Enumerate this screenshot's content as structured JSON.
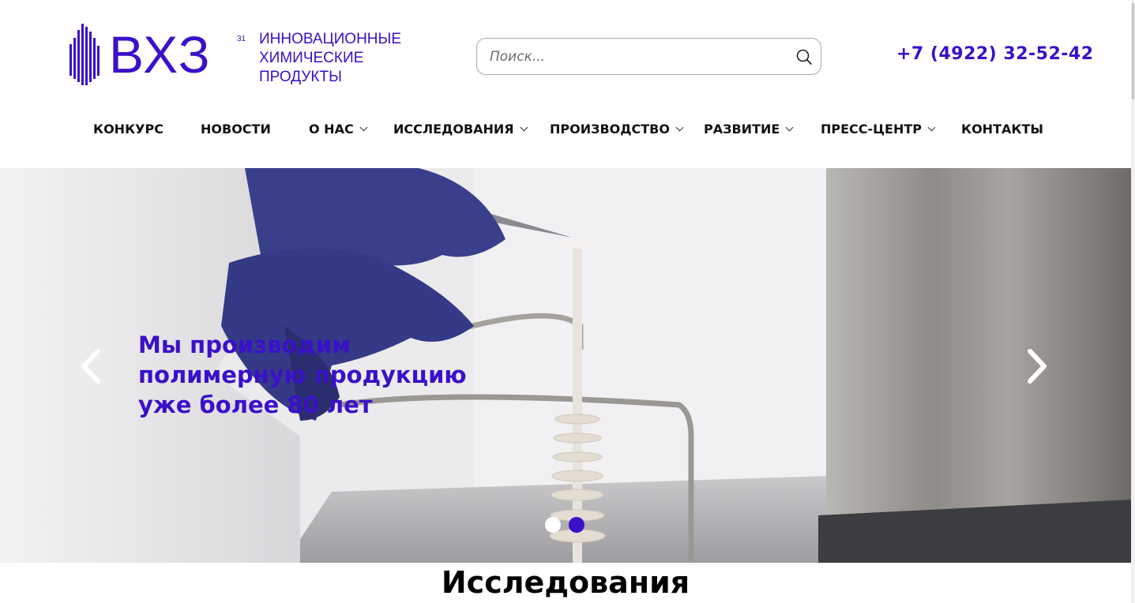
{
  "brand": {
    "name": "ВХЗ",
    "superscript": "31",
    "tagline": [
      "ИННОВАЦИОННЫЕ",
      "ХИМИЧЕСКИЕ",
      "ПРОДУКТЫ"
    ],
    "color": "#3a10c9"
  },
  "search": {
    "placeholder": "Поиск...",
    "value": "",
    "icon": "search-icon"
  },
  "phone": "+7 (4922) 32-52-42",
  "nav": {
    "items": [
      {
        "label": "КОНКУРС",
        "dropdown": false
      },
      {
        "label": "НОВОСТИ",
        "dropdown": false
      },
      {
        "label": "О НАС",
        "dropdown": true
      },
      {
        "label": "ИССЛЕДОВАНИЯ",
        "dropdown": true
      },
      {
        "label": "ПРОИЗВОДСТВО",
        "dropdown": true
      },
      {
        "label": "РАЗВИТИЕ",
        "dropdown": true
      },
      {
        "label": "ПРЕСС-ЦЕНТР",
        "dropdown": true
      },
      {
        "label": "КОНТАКТЫ",
        "dropdown": false
      }
    ]
  },
  "slider": {
    "headline": [
      "Мы производим",
      "полимерную продукцию",
      "уже более 80 лет"
    ],
    "slides_total": 2,
    "active_slide": 2,
    "prev_icon": "chevron-left-icon",
    "next_icon": "chevron-right-icon"
  },
  "section": {
    "title": "Исследования"
  }
}
